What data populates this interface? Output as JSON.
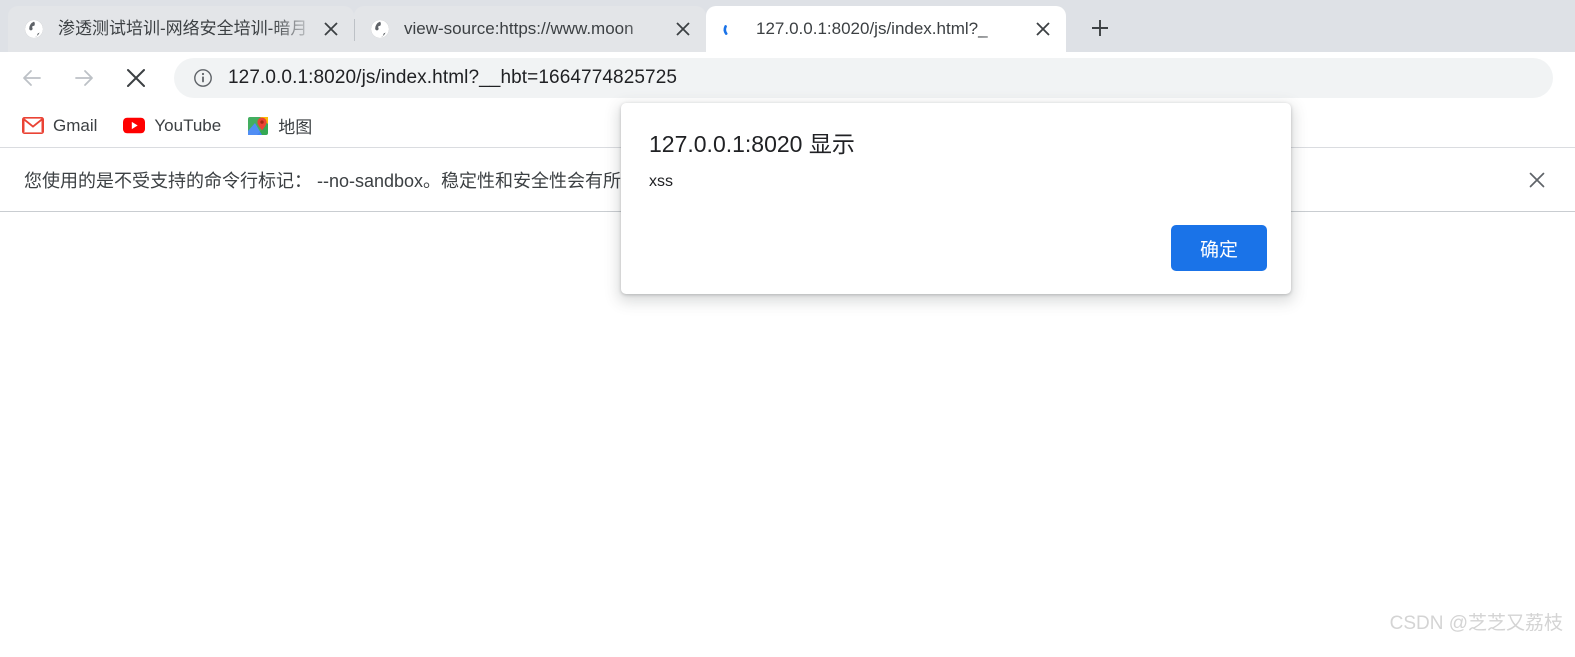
{
  "tabs": [
    {
      "title": "渗透测试培训-网络安全培训-暗月",
      "favicon": "globe-icon",
      "state": "inactive",
      "close_label": "×"
    },
    {
      "title": "view-source:https://www.moon",
      "favicon": "globe-icon",
      "state": "inactive",
      "close_label": "×"
    },
    {
      "title": "127.0.0.1:8020/js/index.html?_",
      "favicon": "loading-spinner-icon",
      "state": "active",
      "close_label": "×"
    }
  ],
  "newtab": {
    "label": "+",
    "icon": "plus-icon"
  },
  "toolbar": {
    "back": {
      "icon": "arrow-left-icon",
      "enabled": false
    },
    "forward": {
      "icon": "arrow-right-icon",
      "enabled": false
    },
    "stop": {
      "icon": "close-x-icon",
      "enabled": true
    },
    "omnibox": {
      "security_icon": "info-circle-icon",
      "url": "127.0.0.1:8020/js/index.html?__hbt=1664774825725"
    }
  },
  "bookmarks": [
    {
      "label": "Gmail",
      "icon": "gmail-icon"
    },
    {
      "label": "YouTube",
      "icon": "youtube-icon"
    },
    {
      "label": "地图",
      "icon": "google-maps-icon"
    }
  ],
  "infobar": {
    "text": "您使用的是不受支持的命令行标记： --no-sandbox。稳定性和安全性会有所下降。",
    "close_label": "×",
    "close_icon": "close-x-icon"
  },
  "dialog": {
    "title": "127.0.0.1:8020 显示",
    "message": "xss",
    "ok_label": "确定"
  },
  "page": {
    "watermark": "CSDN @芝芝又荔枝"
  },
  "colors": {
    "tabstrip_bg": "#dee1e6",
    "tab_inactive": "#e8eaed",
    "tab_active": "#ffffff",
    "omnibox_bg": "#f1f3f4",
    "accent_blue": "#1a73e8",
    "text_primary": "#202124",
    "text_secondary": "#3c4043",
    "watermark": "#d4d4d4",
    "gmail_red": "#ea4335",
    "youtube_red": "#ff0000"
  }
}
